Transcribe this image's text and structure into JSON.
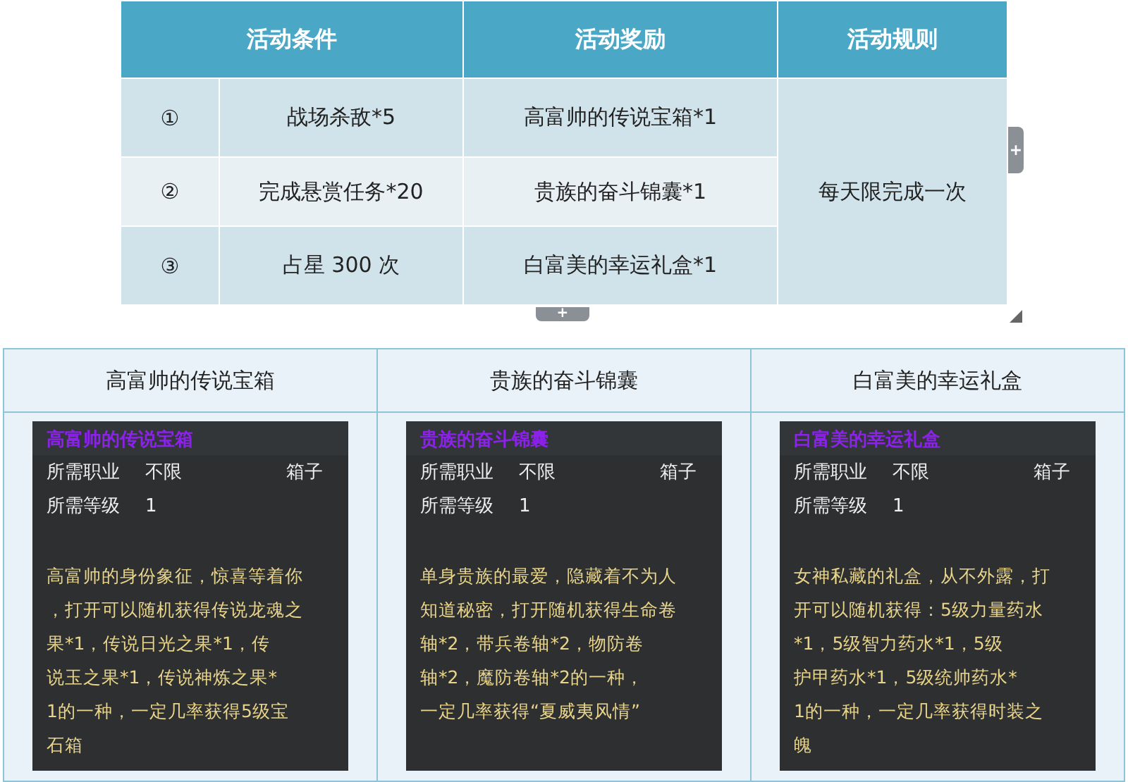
{
  "activity_table": {
    "columns": [
      "活动条件",
      "活动奖励",
      "活动规则"
    ],
    "rows": [
      {
        "index": "①",
        "condition": "战场杀敌*5",
        "reward": "高富帅的传说宝箱*1",
        "highlighted": false
      },
      {
        "index": "②",
        "condition": "完成悬赏任务*20",
        "reward": "贵族的奋斗锦囊*1",
        "highlighted": true
      },
      {
        "index": "③",
        "condition": "占星 300 次",
        "reward": "白富美的幸运礼盒*1",
        "highlighted": false
      }
    ],
    "rule": "每天限完成一次",
    "handles": {
      "right": "+",
      "bottom": "+"
    }
  },
  "items_table": {
    "columns": [
      "高富帅的传说宝箱",
      "贵族的奋斗锦囊",
      "白富美的幸运礼盒"
    ],
    "cards": [
      {
        "title": "高富帅的传说宝箱",
        "fields": [
          {
            "label": "所需职业",
            "value": "不限"
          },
          {
            "label": "所需等级",
            "value": "1"
          }
        ],
        "type": "箱子",
        "description": [
          "高富帅的身份象征，惊喜等着你",
          "，打开可以随机获得传说龙魂之",
          "果*1，传说日光之果*1，传",
          "说玉之果*1，传说神炼之果*",
          "1的一种，一定几率获得5级宝",
          "石箱"
        ]
      },
      {
        "title": "贵族的奋斗锦囊",
        "fields": [
          {
            "label": "所需职业",
            "value": "不限"
          },
          {
            "label": "所需等级",
            "value": "1"
          }
        ],
        "type": "箱子",
        "description": [
          "单身贵族的最爱，隐藏着不为人",
          "知道秘密，打开随机获得生命卷",
          "轴*2，带兵卷轴*2，物防卷",
          "轴*2，魔防卷轴*2的一种，",
          "一定几率获得“夏威夷风情”"
        ]
      },
      {
        "title": "白富美的幸运礼盒",
        "fields": [
          {
            "label": "所需职业",
            "value": "不限"
          },
          {
            "label": "所需等级",
            "value": "1"
          }
        ],
        "type": "箱子",
        "description": [
          "女神私藏的礼盒，从不外露，打",
          "开可以随机获得：5级力量药水",
          "*1，5级智力药水*1，5级",
          "护甲药水*1，5级统帅药水*",
          "1的一种，一定几率获得时装之",
          "魄"
        ]
      }
    ]
  }
}
